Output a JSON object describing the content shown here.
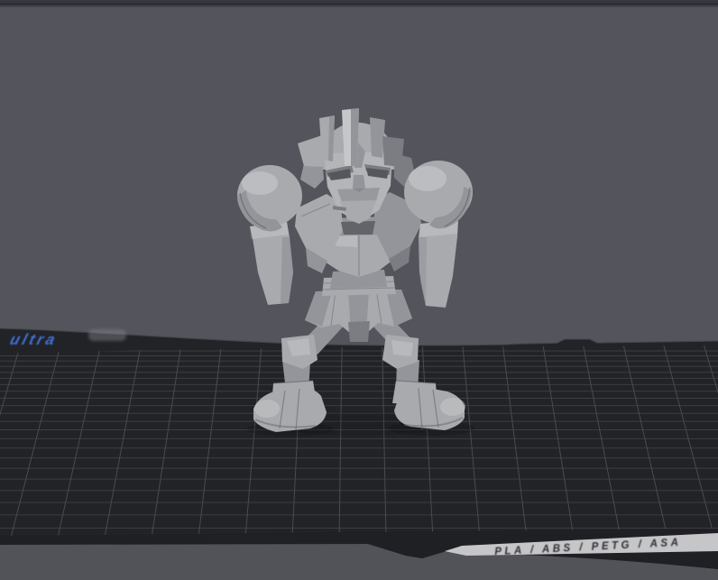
{
  "viewport": {
    "build_plate": {
      "logo_text": "ultra",
      "material_label": "PLA / ABS / PETG / ASA"
    },
    "model": {
      "description": "low-poly chibi boxer robot figurine"
    }
  },
  "colors": {
    "background": "#54555c",
    "background_lower": "#525359",
    "topbar": "#36383e",
    "topbar_line": "#282b2f",
    "topbar_hi": "#45474c",
    "plate": "#222327",
    "plate_front": "#1f2024",
    "plate_edge": "#46474d",
    "grid_row": "#3c3d42",
    "grid_col": "#4a4b50",
    "band_bg": "#c6c6c8",
    "band_text": "#2e2f33",
    "logo_blue": "#3f6fd6",
    "logo_smudge": "#82848a",
    "model_base": "#a9aaae",
    "model_light": "#c6c7c9",
    "model_mid": "#94959a",
    "model_dark": "#7c7d82",
    "model_line": "#636469",
    "model_eye": "#56575c",
    "model_face": "#b4b5b8",
    "shadow": "#0a0a0c"
  }
}
